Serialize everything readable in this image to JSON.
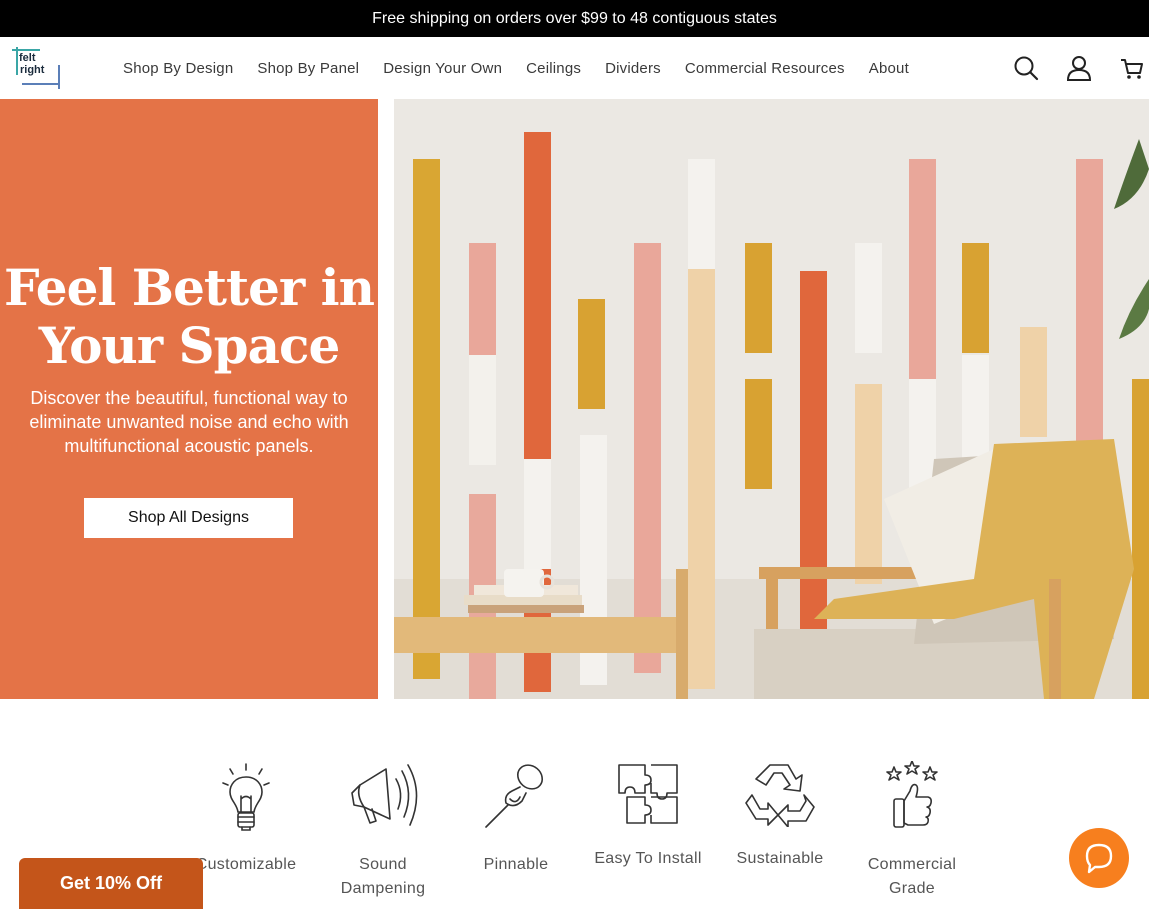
{
  "announcement": "Free shipping on orders over $99 to 48 contiguous states",
  "brand": {
    "line1": "felt",
    "line2": "right"
  },
  "nav": [
    "Shop By Design",
    "Shop By Panel",
    "Design Your Own",
    "Ceilings",
    "Dividers",
    "Commercial Resources",
    "About"
  ],
  "header_icons": [
    "search-icon",
    "account-icon",
    "cart-icon"
  ],
  "hero": {
    "title": "Feel Better in Your Space",
    "subtitle": "Discover the beautiful, functional way to eliminate unwanted noise and echo with multifunctional acoustic panels.",
    "cta": "Shop All Designs",
    "accent_color": "#e47347"
  },
  "features": [
    {
      "label": "Customizable",
      "icon": "lightbulb-icon"
    },
    {
      "label": "Sound Dampening",
      "icon": "speaker-icon"
    },
    {
      "label": "Pinnable",
      "icon": "pushpin-icon"
    },
    {
      "label": "Easy To Install",
      "icon": "puzzle-icon"
    },
    {
      "label": "Sustainable",
      "icon": "recycle-icon"
    },
    {
      "label": "Commercial Grade",
      "icon": "thumbs-up-stars-icon"
    }
  ],
  "promo": "Get 10% Off",
  "chat_icon": "chat-bubble-icon",
  "colors": {
    "promo": "#c4551a",
    "chat": "#f77f1e"
  }
}
